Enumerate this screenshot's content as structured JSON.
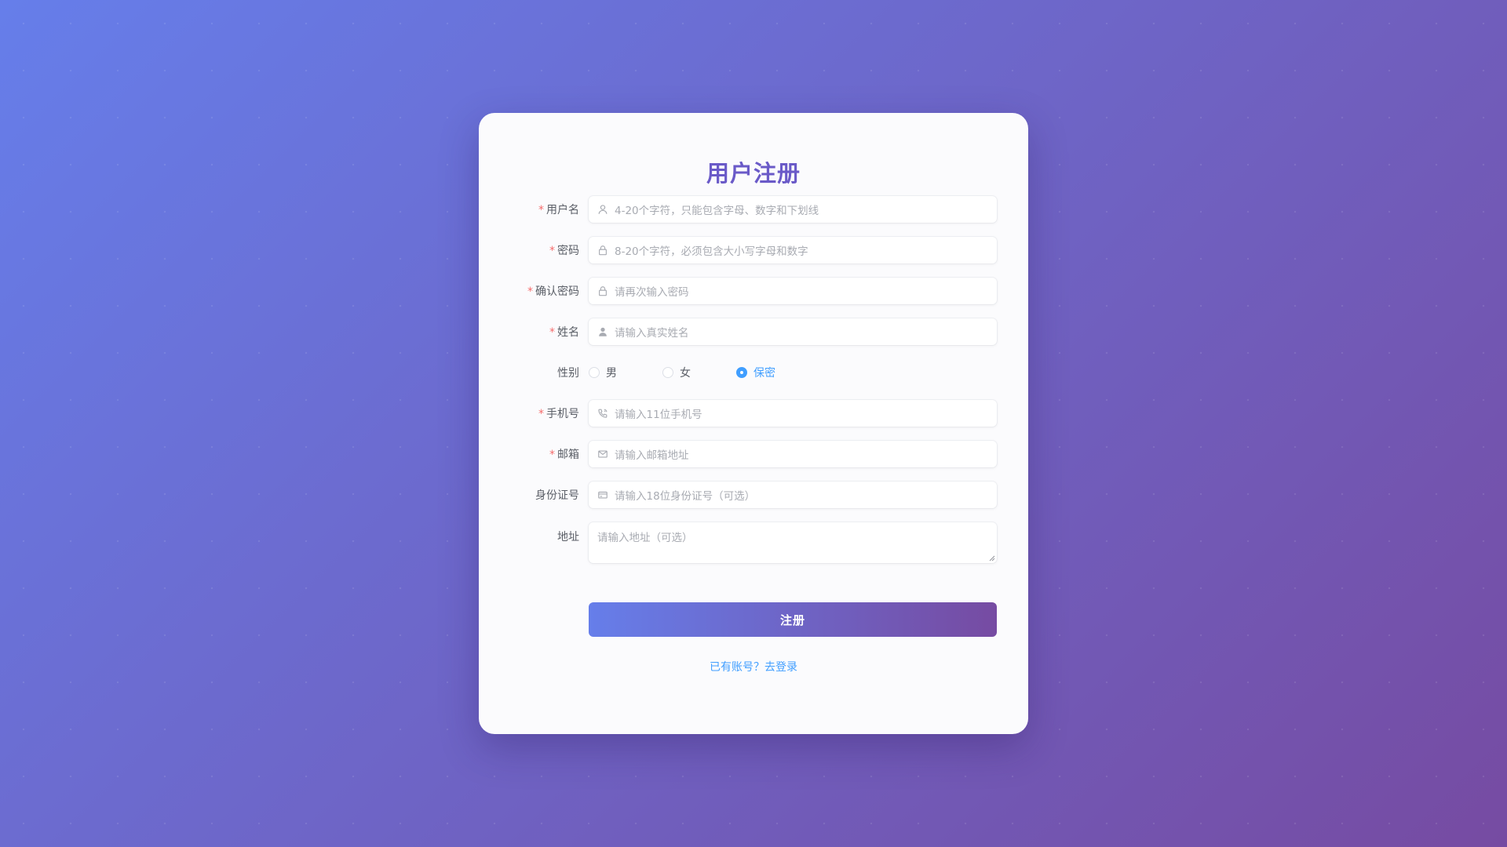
{
  "form": {
    "title": "用户注册",
    "fields": {
      "username": {
        "required": "*",
        "label": "用户名",
        "placeholder": "4-20个字符，只能包含字母、数字和下划线",
        "icon": "user-outline-icon"
      },
      "password": {
        "required": "*",
        "label": "密码",
        "placeholder": "8-20个字符，必须包含大小写字母和数字",
        "icon": "lock-icon"
      },
      "confirm_password": {
        "required": "*",
        "label": "确认密码",
        "placeholder": "请再次输入密码",
        "icon": "lock-icon"
      },
      "real_name": {
        "required": "*",
        "label": "姓名",
        "placeholder": "请输入真实姓名",
        "icon": "user-filled-icon"
      },
      "gender": {
        "label": "性别",
        "options": [
          "男",
          "女",
          "保密"
        ],
        "selected": "保密"
      },
      "phone": {
        "required": "*",
        "label": "手机号",
        "placeholder": "请输入11位手机号",
        "icon": "phone-icon"
      },
      "email": {
        "required": "*",
        "label": "邮箱",
        "placeholder": "请输入邮箱地址",
        "icon": "mail-icon"
      },
      "id_number": {
        "label": "身份证号",
        "placeholder": "请输入18位身份证号（可选）",
        "icon": "credit-card-icon"
      },
      "address": {
        "label": "地址",
        "placeholder": "请输入地址（可选）"
      }
    },
    "submit_label": "注册",
    "login_link": "已有账号？去登录"
  },
  "colors": {
    "background_start": "#667eea",
    "background_end": "#764ba2",
    "title": "#6a5ac8",
    "required": "#f56c6c",
    "link": "#409eff"
  }
}
